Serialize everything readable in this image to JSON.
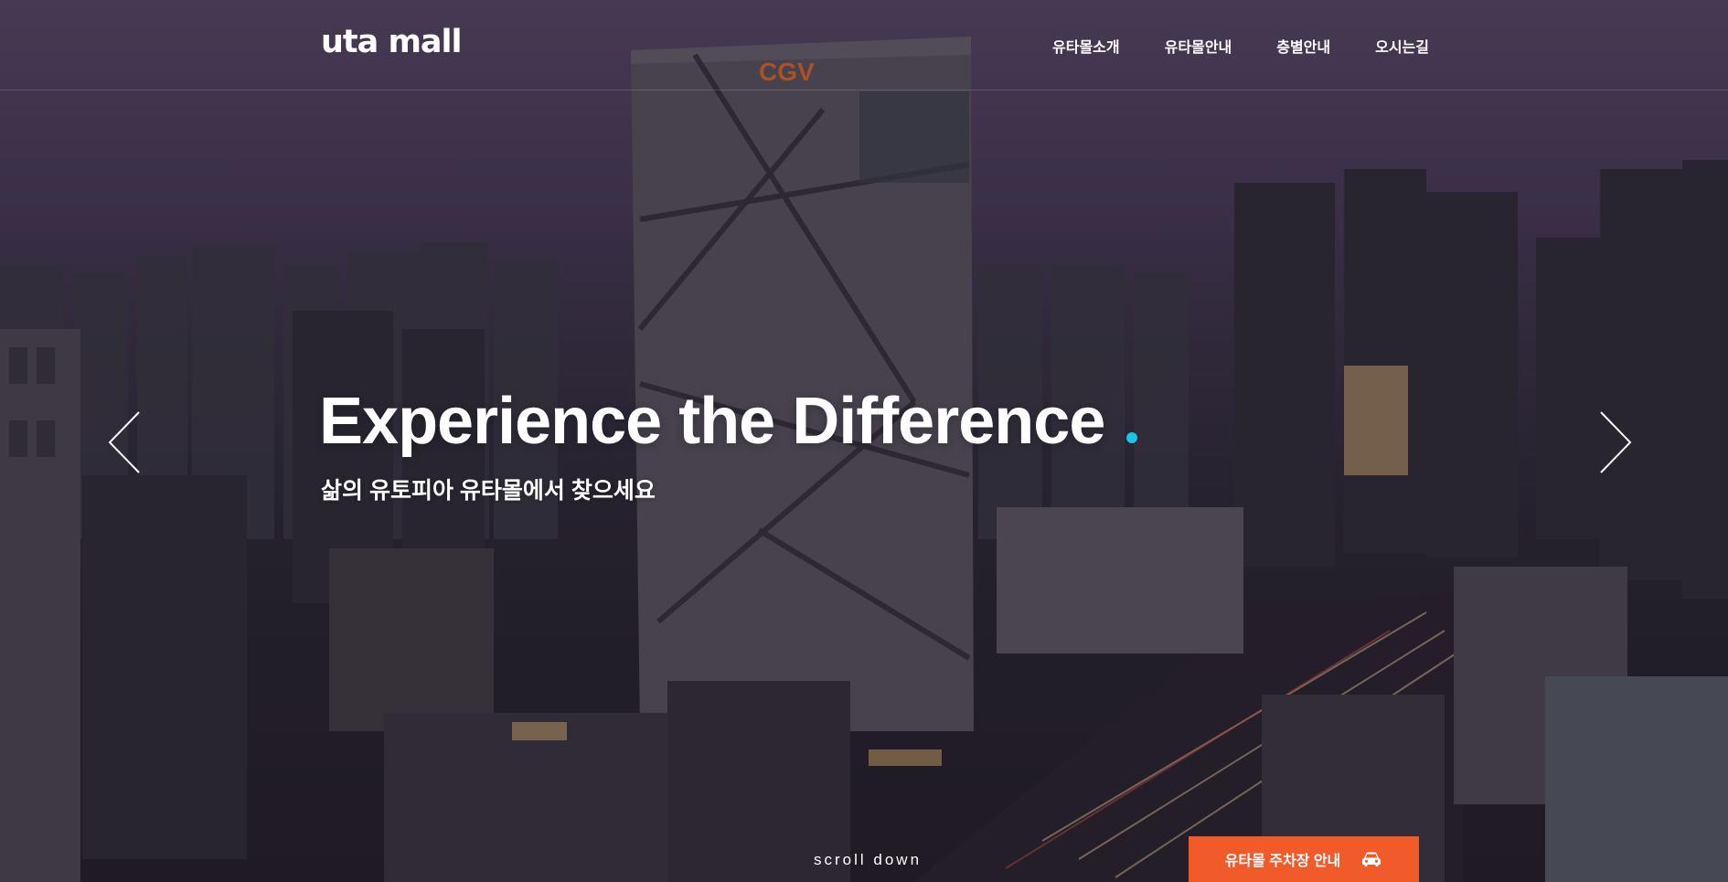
{
  "header": {
    "logo": "uta mall",
    "nav": [
      {
        "label": "유타몰소개"
      },
      {
        "label": "유타몰안내"
      },
      {
        "label": "층별안내"
      },
      {
        "label": "오시는길"
      }
    ]
  },
  "hero": {
    "title": "Experience the Difference",
    "subtitle": "삶의 유토피아 유타몰에서 찾으세요",
    "accent_color": "#19c4e8",
    "prev_icon": "chevron-left-icon",
    "next_icon": "chevron-right-icon"
  },
  "scroll": {
    "label": "scroll down"
  },
  "parking": {
    "label": "유타몰 주차장 안내",
    "icon": "car-icon",
    "color": "#f15a29"
  }
}
